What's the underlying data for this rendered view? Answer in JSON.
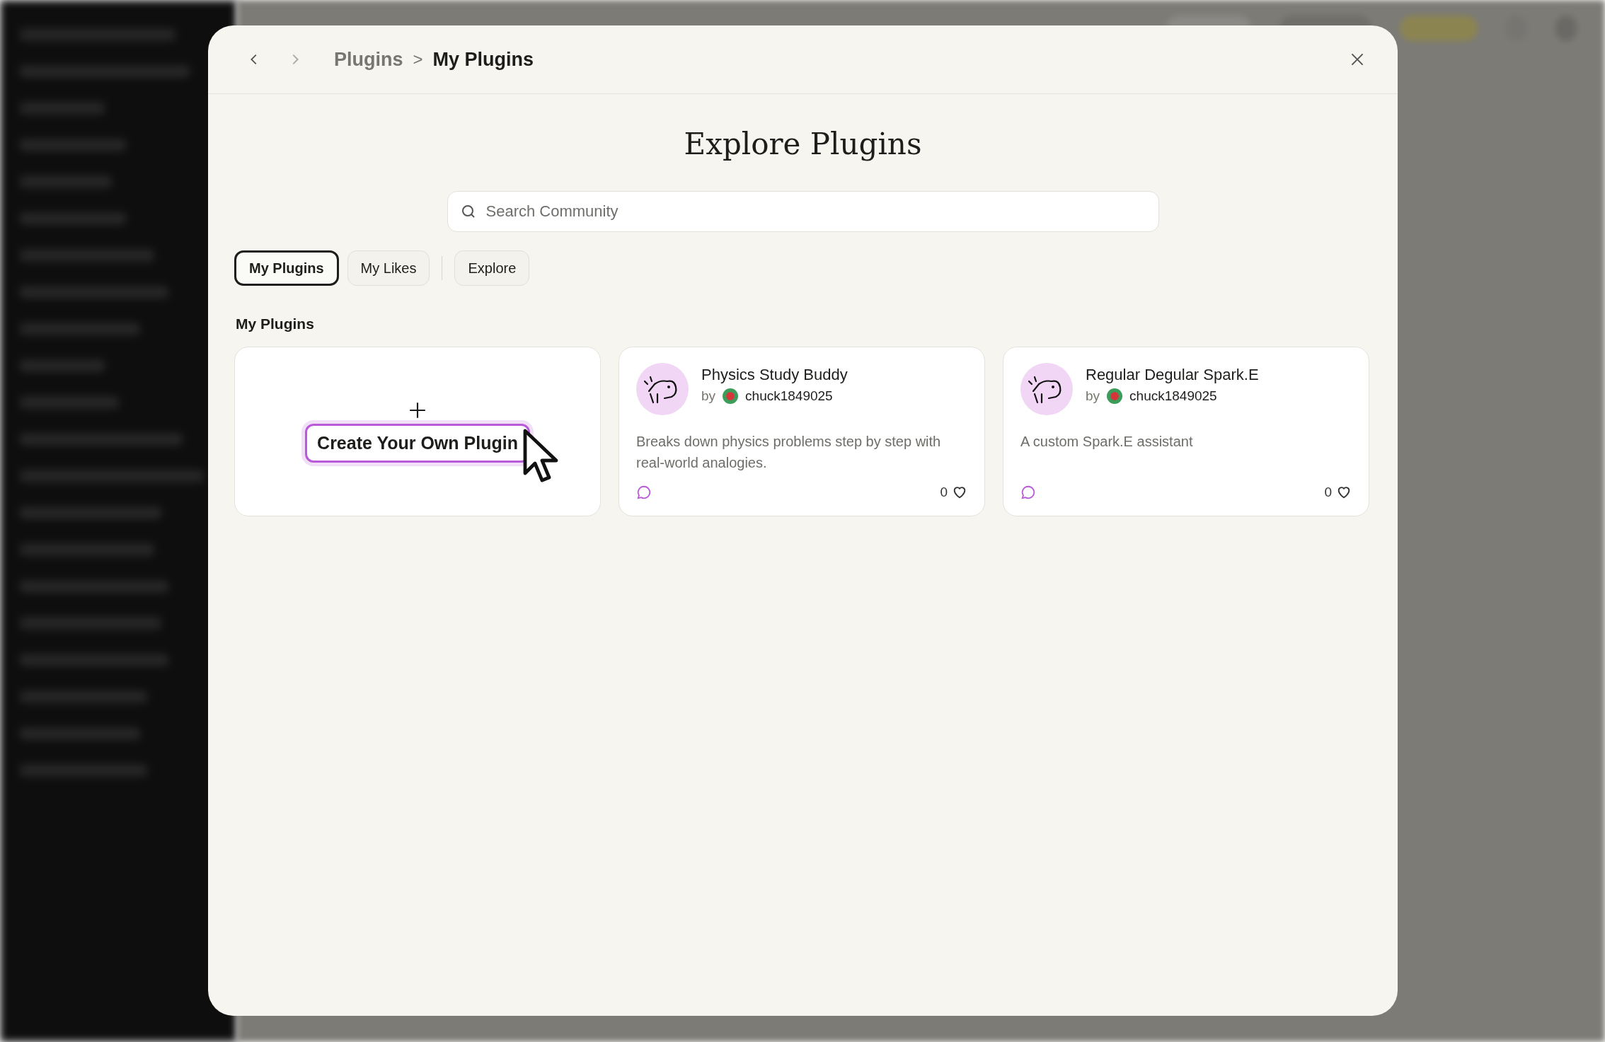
{
  "nav": {
    "back_disabled": false,
    "forward_disabled": true
  },
  "breadcrumb": {
    "parent": "Plugins",
    "separator": ">",
    "current": "My Plugins"
  },
  "title": "Explore Plugins",
  "search": {
    "placeholder": "Search Community"
  },
  "tabs": [
    {
      "label": "My Plugins",
      "selected": true
    },
    {
      "label": "My Likes",
      "selected": false
    },
    {
      "label": "Explore",
      "selected": false
    }
  ],
  "section_title": "My Plugins",
  "create_card": {
    "label": "Create Your Own Plugin"
  },
  "plugins": [
    {
      "name": "Physics Study Buddy",
      "by": "by",
      "author": "chuck1849025",
      "description": "Breaks down physics problems step by step with real-world analogies.",
      "likes": "0"
    },
    {
      "name": "Regular Degular Spark.E",
      "by": "by",
      "author": "chuck1849025",
      "description": "A custom Spark.E assistant",
      "likes": "0"
    }
  ]
}
